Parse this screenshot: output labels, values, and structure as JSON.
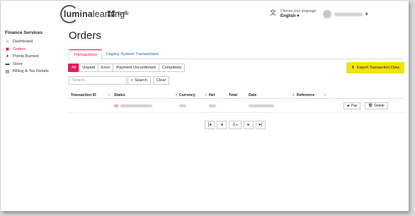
{
  "header": {
    "logo_text_bold": "lumina",
    "logo_text_regular": "learning",
    "logo_reg": "®",
    "portal_label": "Portal",
    "language_caption": "Choose your language",
    "language_value": "English",
    "language_chevron": "▾",
    "user_chevron": "▾"
  },
  "sidebar": {
    "title": "Finance Services",
    "items": [
      {
        "label": "Dashboard",
        "icon": "dashboard-icon",
        "glyph": "⌂"
      },
      {
        "label": "Orders",
        "icon": "orders-icon",
        "glyph": "▣"
      },
      {
        "label": "Points Burned",
        "icon": "flame-icon",
        "glyph": "♦"
      },
      {
        "label": "Store",
        "icon": "cart-icon",
        "glyph": "▬"
      },
      {
        "label": "Billing & Tax Details",
        "icon": "billing-icon",
        "glyph": "▤"
      }
    ]
  },
  "main": {
    "title": "Orders",
    "tabs": [
      {
        "label": "Transactions",
        "active": true
      },
      {
        "label": "Legacy System Transactions",
        "active": false
      }
    ],
    "filters": [
      "All",
      "Unpaid",
      "Error",
      "Payment Unconfirmed",
      "Completed"
    ],
    "active_filter": "All",
    "export_label": "Export Transaction Data",
    "search": {
      "placeholder": "Search",
      "button_label": "Search",
      "clear_label": "Clear"
    },
    "table": {
      "columns": [
        "Transaction ID",
        "Status",
        "Currency",
        "Net",
        "Total",
        "Date",
        "Reference"
      ],
      "row_buttons": {
        "pay": "Pay",
        "delete": "Delete"
      }
    },
    "pagination": {
      "first": "|◂",
      "prev": "◂",
      "page": "1",
      "next": "▸",
      "last": "▸|"
    }
  },
  "colors": {
    "accent": "#e8175d",
    "export": "#f5e20b",
    "link": "#1a5fa8"
  }
}
